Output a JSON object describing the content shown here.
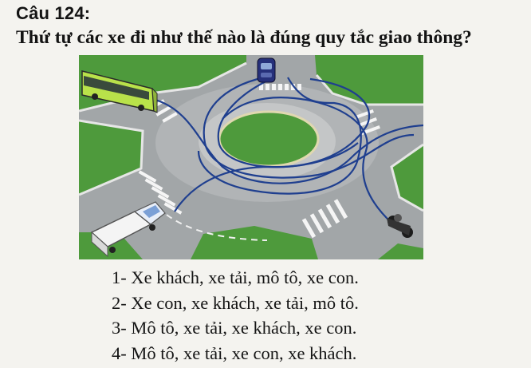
{
  "question": {
    "number": "Câu 124:",
    "text": "Thứ tự các xe đi như thế nào là đúng quy tắc giao thông?"
  },
  "figure": {
    "vehicles": [
      "bus",
      "car",
      "truck",
      "motorcycle"
    ]
  },
  "options": [
    "1- Xe khách, xe tải, mô tô, xe con.",
    "2- Xe con, xe khách, xe tải, mô tô.",
    "3- Mô tô, xe tải, xe khách, xe con.",
    "4- Mô tô, xe tải, xe con, xe khách."
  ],
  "colors": {
    "background": "#f4f3ef",
    "text": "#141414",
    "grass": "#4e9a3c",
    "road": "#9ea3a6",
    "path": "#1f3f8f"
  }
}
